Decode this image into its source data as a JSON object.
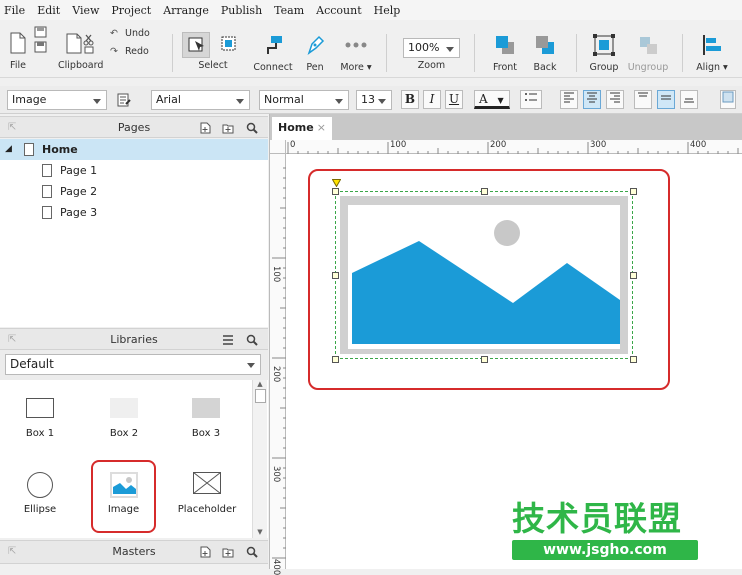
{
  "menu": [
    "File",
    "Edit",
    "View",
    "Project",
    "Arrange",
    "Publish",
    "Team",
    "Account",
    "Help"
  ],
  "toolbar": {
    "file": "File",
    "clipboard": "Clipboard",
    "undo": "Undo",
    "redo": "Redo",
    "select": "Select",
    "connect": "Connect",
    "pen": "Pen",
    "more": "More ▾",
    "zoom_value": "100%",
    "zoom": "Zoom",
    "front": "Front",
    "back": "Back",
    "group": "Group",
    "ungroup": "Ungroup",
    "align": "Align ▾"
  },
  "format": {
    "widget_type": "Image",
    "font": "Arial",
    "style": "Normal",
    "size": "13",
    "bold": "B",
    "italic": "I",
    "underline": "U",
    "text_color": "A"
  },
  "pages_panel": {
    "title": "Pages",
    "home": "Home",
    "pages": [
      "Page 1",
      "Page 2",
      "Page 3"
    ]
  },
  "libraries_panel": {
    "title": "Libraries",
    "selected": "Default",
    "items": [
      "Box 1",
      "Box 2",
      "Box 3",
      "Ellipse",
      "Image",
      "Placeholder"
    ]
  },
  "masters_panel": {
    "title": "Masters"
  },
  "canvas": {
    "tab": "Home",
    "tab_close": "×",
    "ruler_h": [
      "0",
      "100",
      "200",
      "300",
      "400"
    ],
    "ruler_v": [
      "100",
      "200",
      "300",
      "400"
    ]
  },
  "watermark": {
    "title": "技术员联盟",
    "url": "www.jsgho.com"
  },
  "colors": {
    "accent_blue": "#1b9bd7",
    "highlight_red": "#d62b2b",
    "watermark_green": "#2fb648"
  }
}
